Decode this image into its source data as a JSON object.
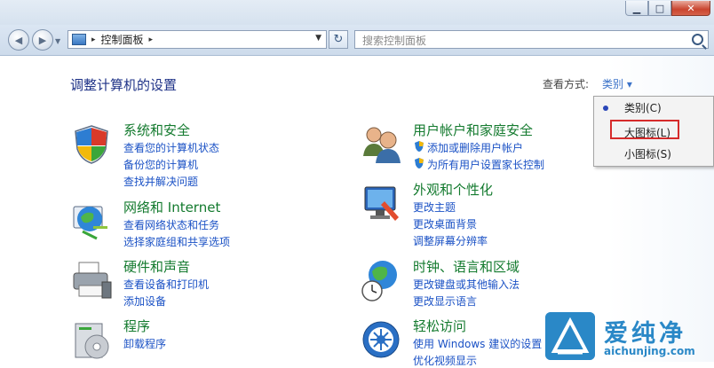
{
  "window": {
    "minimize_glyph": "▁",
    "maximize_glyph": "□",
    "close_glyph": "✕"
  },
  "address": {
    "path": "控制面板",
    "sep": "▸",
    "sep2": "▸"
  },
  "search": {
    "placeholder": "搜索控制面板"
  },
  "heading": "调整计算机的设置",
  "view": {
    "label": "查看方式:",
    "current": "类别 ▾"
  },
  "categories": [
    {
      "title": "系统和安全",
      "links": [
        "查看您的计算机状态",
        "备份您的计算机",
        "查找并解决问题"
      ],
      "icon": "shield-icon"
    },
    {
      "title": "网络和 Internet",
      "links": [
        "查看网络状态和任务",
        "选择家庭组和共享选项"
      ],
      "icon": "network-globe-icon"
    },
    {
      "title": "硬件和声音",
      "links": [
        "查看设备和打印机",
        "添加设备"
      ],
      "icon": "printer-icon"
    },
    {
      "title": "程序",
      "links": [
        "卸载程序"
      ],
      "icon": "programs-icon"
    },
    {
      "title": "用户帐户和家庭安全",
      "links": [
        "添加或删除用户帐户",
        "为所有用户设置家长控制"
      ],
      "icon": "users-icon"
    },
    {
      "title": "外观和个性化",
      "links": [
        "更改主题",
        "更改桌面背景",
        "调整屏幕分辨率"
      ],
      "icon": "monitor-icon"
    },
    {
      "title": "时钟、语言和区域",
      "links": [
        "更改键盘或其他输入法",
        "更改显示语言"
      ],
      "icon": "clock-globe-icon"
    },
    {
      "title": "轻松访问",
      "links": [
        "使用 Windows 建议的设置",
        "优化视频显示"
      ],
      "icon": "ease-of-access-icon"
    }
  ],
  "view_menu": {
    "items": [
      "类别(C)",
      "大图标(L)",
      "小图标(S)"
    ],
    "selected": "类别(C)",
    "highlighted": "大图标(L)"
  },
  "watermark": {
    "text": "爱纯净",
    "url": "aichunjing.com"
  },
  "colors": {
    "category_title": "#137a2e",
    "link": "#1a51c5",
    "heading": "#1e3287",
    "highlight_border": "#d62b2b",
    "watermark": "#2a88c7"
  }
}
